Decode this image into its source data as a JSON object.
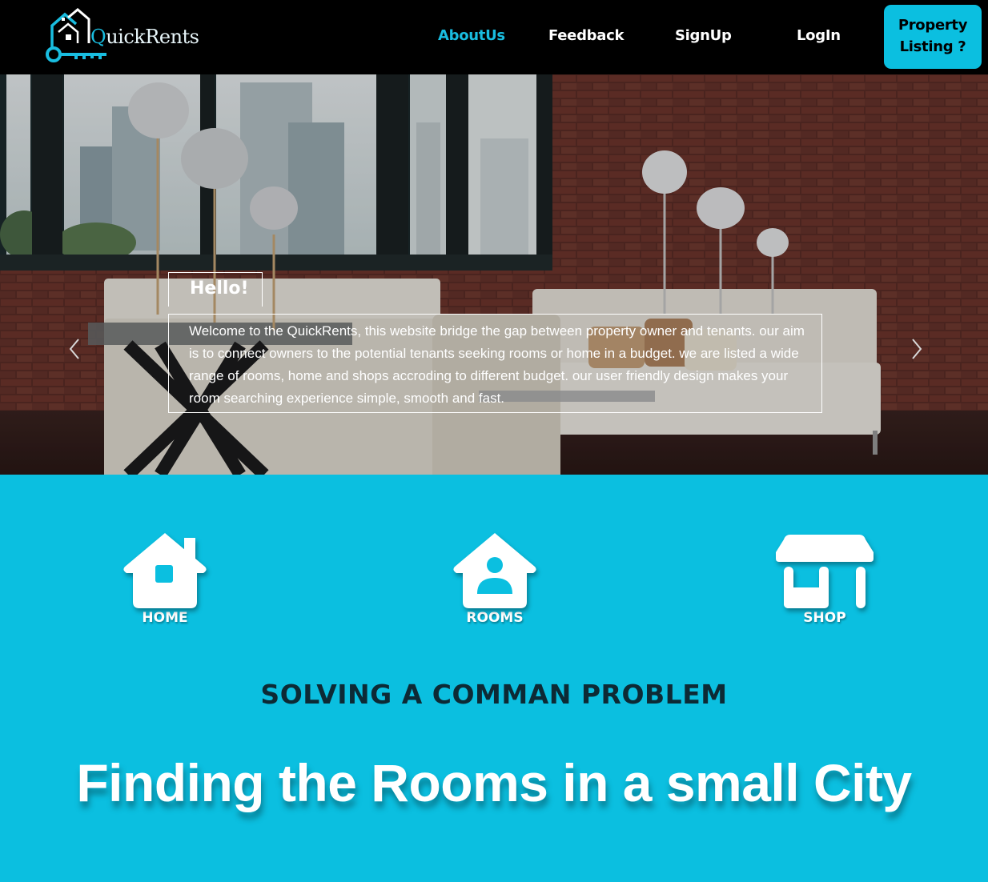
{
  "brand": {
    "name_prefix": "Q",
    "name_rest": "uickRents",
    "accent": "#19bde0"
  },
  "nav": {
    "links": [
      {
        "label": "AboutUs",
        "active": true
      },
      {
        "label": "Feedback",
        "active": false
      },
      {
        "label": "SignUp",
        "active": false
      },
      {
        "label": "LogIn",
        "active": false
      }
    ],
    "cta": {
      "line1": "Property",
      "line2": "Listing ?"
    }
  },
  "hero": {
    "title": "Hello!",
    "text": "Welcome to the QuickRents, this website bridge the gap between property owner and tenants. our aim is to connect owners to the potential tenants seeking rooms or home in a budget. we are listed a wide range of rooms, home and shops accroding to different budget. our user friendly design makes your room searching experience simple, smooth and fast.",
    "prev_icon": "chevron-left-icon",
    "next_icon": "chevron-right-icon"
  },
  "categories": [
    {
      "label": "HOME",
      "icon": "house-icon"
    },
    {
      "label": "ROOMS",
      "icon": "house-user-icon"
    },
    {
      "label": "SHOP",
      "icon": "shop-icon"
    }
  ],
  "subtitle": "SOLVING A COMMAN PROBLEM",
  "headline": "Finding the Rooms in a small City",
  "colors": {
    "background": "#0bbfe0",
    "navbar": "#000000",
    "subtitle": "#0d2a35"
  }
}
